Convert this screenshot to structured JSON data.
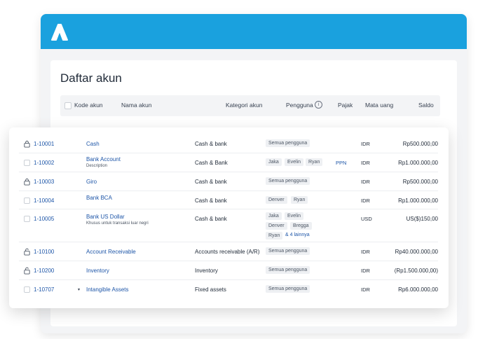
{
  "app": {
    "brand_color": "#1aa1de",
    "logo_icon": "jurnal-a-logo-icon"
  },
  "page": {
    "title": "Daftar akun"
  },
  "table": {
    "headers": {
      "code": "Kode akun",
      "name": "Nama akun",
      "category": "Kategori akun",
      "users": "Pengguna",
      "tax": "Pajak",
      "currency": "Mata uang",
      "balance": "Saldo"
    },
    "rows": [
      {
        "lead": "lock-icon",
        "code": "1-10001",
        "name": "Cash",
        "desc": "",
        "category": "Cash & bank",
        "users": [
          "Semua pengguna"
        ],
        "more": "",
        "tax": "",
        "currency": "IDR",
        "balance": "Rp500.000,00"
      },
      {
        "lead": "checkbox",
        "code": "1-10002",
        "name": "Bank Account",
        "desc": "Description",
        "category": "Cash & Bank",
        "users": [
          "Jaka",
          "Evelin",
          "Ryan"
        ],
        "more": "",
        "tax": "PPN",
        "currency": "IDR",
        "balance": "Rp1.000.000,00"
      },
      {
        "lead": "lock-icon",
        "code": "1-10003",
        "name": "Giro",
        "desc": "",
        "category": "Cash & bank",
        "users": [
          "Semua pengguna"
        ],
        "more": "",
        "tax": "",
        "currency": "IDR",
        "balance": "Rp500.000,00"
      },
      {
        "lead": "checkbox",
        "code": "1-10004",
        "name": "Bank BCA",
        "desc": "",
        "category": "Cash & bank",
        "users": [
          "Denver",
          "Ryan"
        ],
        "more": "",
        "tax": "",
        "currency": "IDR",
        "balance": "Rp1.000.000,00"
      },
      {
        "lead": "checkbox",
        "code": "1-10005",
        "name": "Bank US Dollar",
        "desc": "Khusus untuk transaksi luar negri",
        "category": "Cash & bank",
        "users": [
          "Jaka",
          "Evelin",
          "Denver",
          "Bregga",
          "Ryan"
        ],
        "more": "& 4 lainnya",
        "tax": "",
        "currency": "USD",
        "balance": "US($)150,00"
      },
      {
        "lead": "unlock-icon",
        "code": "1-10100",
        "name": "Account Receivable",
        "desc": "",
        "category": "Accounts receivable (A/R)",
        "users": [
          "Semua pengguna"
        ],
        "more": "",
        "tax": "",
        "currency": "IDR",
        "balance": "Rp40.000.000,00"
      },
      {
        "lead": "unlock-icon",
        "code": "1-10200",
        "name": "Inventory",
        "desc": "",
        "category": "Inventory",
        "users": [
          "Semua pengguna"
        ],
        "more": "",
        "tax": "",
        "currency": "IDR",
        "balance": "(Rp1.500.000,00)"
      },
      {
        "lead": "checkbox",
        "code": "1-10707",
        "name": "Intangible Assets",
        "desc": "",
        "category": "Fixed assets",
        "users": [
          "Semua pengguna"
        ],
        "more": "",
        "tax": "",
        "currency": "IDR",
        "balance": "Rp6.000.000,00",
        "caret": "▾"
      }
    ]
  }
}
